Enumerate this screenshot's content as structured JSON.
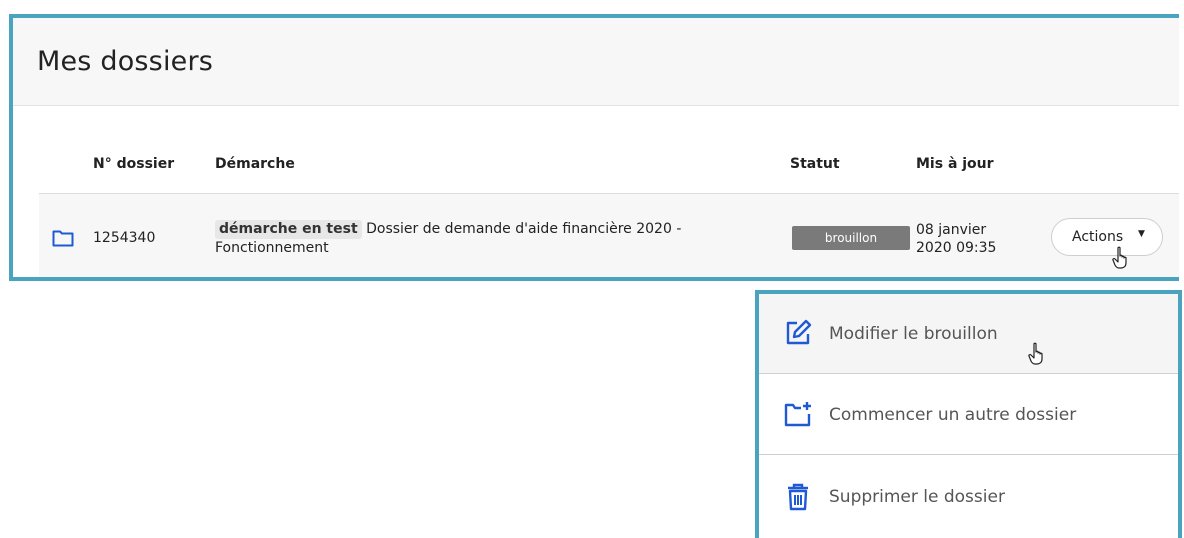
{
  "page": {
    "title": "Mes dossiers"
  },
  "table": {
    "headers": {
      "number": "N° dossier",
      "procedure": "Démarche",
      "status": "Statut",
      "updated": "Mis à jour"
    },
    "rows": [
      {
        "number": "1254340",
        "tag": "démarche en test",
        "procedure_line1": "Dossier de demande d'aide financière 2020 -",
        "procedure_line2": "Fonctionnement",
        "status": "brouillon",
        "updated_line1": "08 janvier",
        "updated_line2": "2020 09:35",
        "actions_label": "Actions",
        "actions_caret": "▼"
      }
    ]
  },
  "dropdown": {
    "items": [
      {
        "label": "Modifier le brouillon",
        "icon": "edit-icon"
      },
      {
        "label": "Commencer un autre dossier",
        "icon": "new-folder-icon"
      },
      {
        "label": "Supprimer le dossier",
        "icon": "trash-icon"
      }
    ]
  },
  "colors": {
    "highlight_border": "#4aa3bf",
    "icon_blue": "#1f5ad4",
    "status_badge": "#7a7a7a"
  }
}
